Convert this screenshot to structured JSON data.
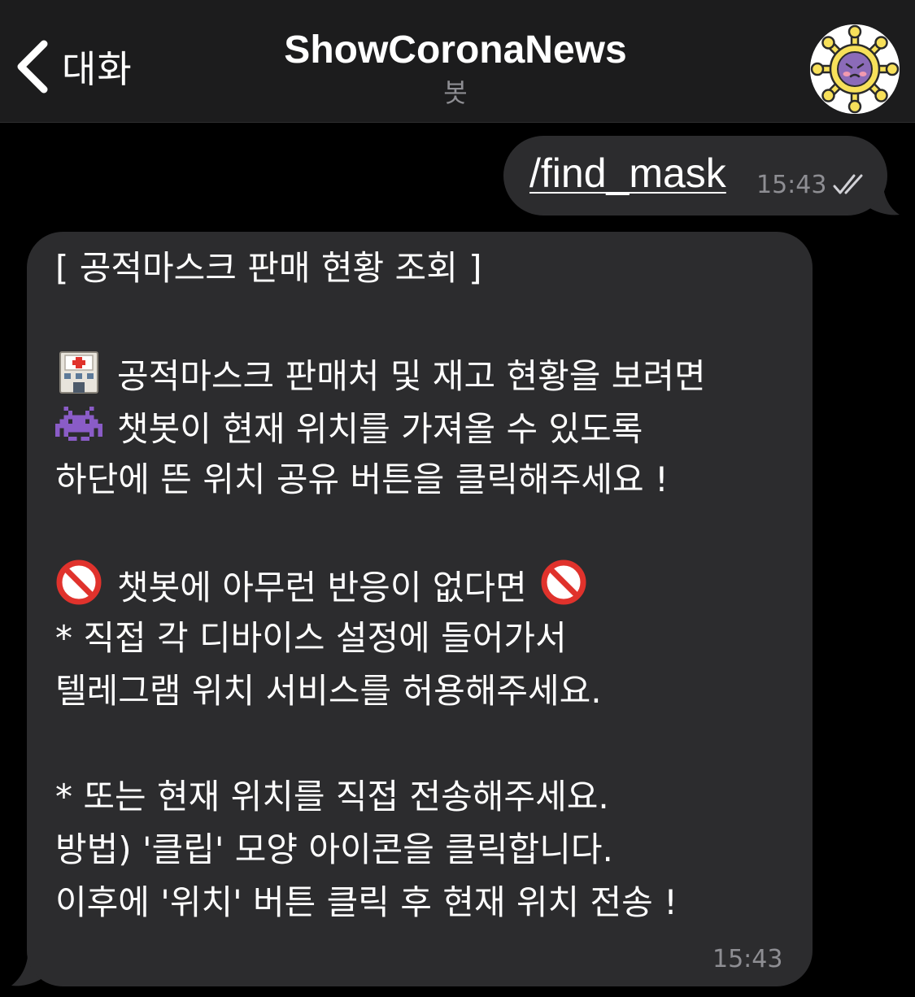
{
  "header": {
    "back_label": "대화",
    "title": "ShowCoronaNews",
    "subtitle": "봇"
  },
  "messages": {
    "outgoing": {
      "text": "/find_mask",
      "time": "15:43"
    },
    "incoming": {
      "title_line": "[ 공적마스크 판매 현황 조회 ]",
      "line_1": "공적마스크 판매처 및 재고 현황을 보려면",
      "line_2": "챗봇이 현재 위치를 가져올 수 있도록",
      "line_3": "하단에 뜬 위치 공유 버튼을 클릭해주세요 !",
      "line_4": "챗봇에 아무런 반응이 없다면",
      "line_5": "* 직접 각 디바이스 설정에 들어가서",
      "line_6": "텔레그램 위치 서비스를 허용해주세요.",
      "line_7": "* 또는 현재 위치를 직접 전송해주세요.",
      "line_8": "방법) '클립' 모양 아이콘을 클릭합니다.",
      "line_9": "이후에 '위치' 버튼 클릭 후 현재 위치 전송 !",
      "time": "15:43"
    }
  },
  "icons": {
    "back": "chevron-left-icon",
    "avatar": "virus-avatar-icon",
    "read": "double-check-icon",
    "line_1_emoji": "hospital-icon",
    "line_2_emoji": "alien-monster-icon",
    "line_4_emoji": "prohibited-icon"
  },
  "colors": {
    "background": "#000000",
    "header": "#1c1c1d",
    "bubble": "#2c2c2e",
    "text": "#ffffff",
    "secondary_text": "#8e8e93"
  }
}
